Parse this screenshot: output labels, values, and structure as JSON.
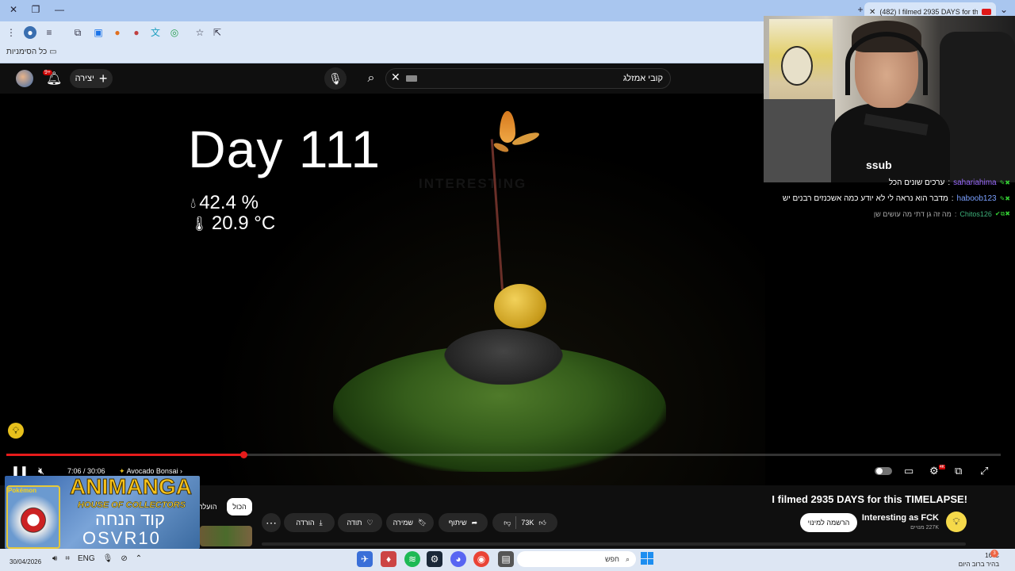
{
  "browser": {
    "tab_title": "(482) I filmed 2935 DAYS for th",
    "bookmarks_label": "כל הסימניות"
  },
  "youtube_header": {
    "create_label": "יצירה",
    "notification_badge": "9+",
    "search_value": "קובי אמזלג"
  },
  "video": {
    "overlay_day": "Day 111",
    "overlay_humidity": "42.4 %",
    "overlay_temperature": "20.9 °C",
    "watermark": "INTERESTING",
    "progress": 0.2387,
    "time": "7:06 / 30:06",
    "chapter": "Avocado Bonsai",
    "hd_badge": "4K"
  },
  "info": {
    "title": "I filmed 2935 DAYS for this TIMELAPSE!",
    "channel_name": "Interesting as FCK",
    "subscribers": "227K מנויים",
    "subscribe_label": "הרשמה למינוי",
    "like_count": "73K",
    "share_label": "שיתוף",
    "save_label": "שמירה",
    "thanks_label": "תודה",
    "download_label": "הורדה",
    "chip_all": "הכול",
    "chip_uploads": "הועלה"
  },
  "promo": {
    "brand": "ANIMANGA",
    "subtitle": "HOUSE OF COLLECTORS",
    "code_label": "קוד הנחה",
    "code": "OSVR10",
    "card_text": "Pokémon"
  },
  "webcam": {
    "shirt_text": "ssub"
  },
  "chat": [
    {
      "user": "sahariahima",
      "message": "ערכים שונים הכל"
    },
    {
      "user": "haboob123",
      "message": "מדבר הוא נראה לי לא יודע כמה אשכנזים רבנים יש"
    },
    {
      "user": "Chitos126",
      "message": "מה זה גן דתי מה עושים שן"
    }
  ],
  "taskbar": {
    "date": "30/04/2026",
    "language": "ENG",
    "search_label": "חפש",
    "weather_temp": "16°C",
    "weather_text": "בהיר ברוב היום",
    "weather_badge": "3"
  },
  "colors": {
    "youtube_red": "#e61b1b",
    "background": "#0f0f0f",
    "browser_frame": "#a9c6ef"
  }
}
